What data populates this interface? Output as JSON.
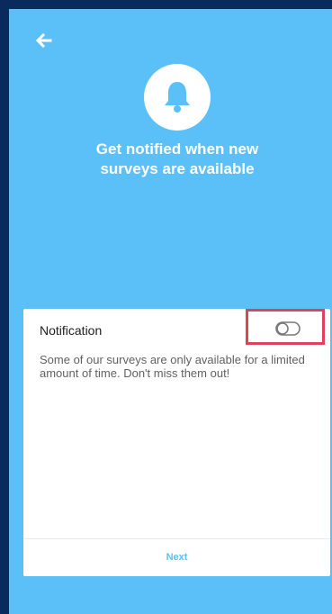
{
  "header": {
    "back_icon": "arrow-left-icon",
    "bell_icon": "bell-icon",
    "headline_line1": "Get notified when new",
    "headline_line2": "surveys are available"
  },
  "card": {
    "title": "Notification",
    "toggle_state": "off",
    "description": "Some of our surveys are only available for a limited amount of time. Don't miss them out!",
    "next_label": "Next"
  },
  "colors": {
    "background": "#5bc0f8",
    "card": "#ffffff",
    "highlight": "#e04358",
    "outer_frame": "#0a2a5e"
  }
}
